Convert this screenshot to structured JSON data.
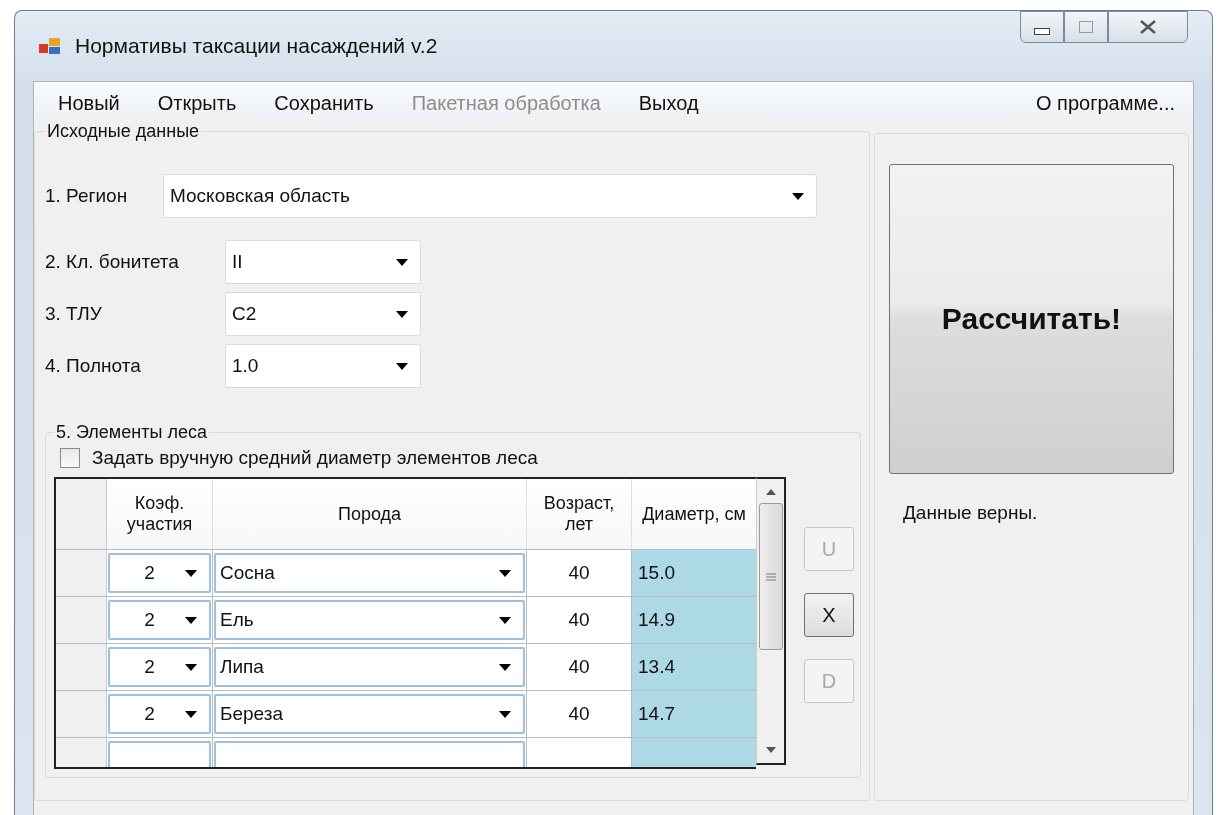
{
  "window": {
    "title": "Нормативы таксации насаждений v.2"
  },
  "menu": [
    {
      "label": "Новый",
      "disabled": false
    },
    {
      "label": "Открыть",
      "disabled": false
    },
    {
      "label": "Сохранить",
      "disabled": false
    },
    {
      "label": "Пакетная обработка",
      "disabled": true
    },
    {
      "label": "Выход",
      "disabled": false
    }
  ],
  "about_menu": "О программе...",
  "input_group": {
    "title": "Исходные данные",
    "fields": [
      {
        "label": "1. Регион",
        "value": "Московская область",
        "kind": "wide"
      },
      {
        "label": "2. Кл. бонитета",
        "value": "II",
        "kind": "short"
      },
      {
        "label": "3. ТЛУ",
        "value": "C2",
        "kind": "short"
      },
      {
        "label": "4. Полнота",
        "value": "1.0",
        "kind": "short"
      }
    ]
  },
  "elements": {
    "title": "5. Элементы леса",
    "checkbox": {
      "label": "Задать вручную средний диаметр элементов леса",
      "checked": false
    },
    "columns": [
      "Коэф. участия",
      "Порода",
      "Возраст, лет",
      "Диаметр, см"
    ],
    "rows": [
      {
        "share": "2",
        "species": "Сосна",
        "age": "40",
        "diameter": "15.0"
      },
      {
        "share": "2",
        "species": "Ель",
        "age": "40",
        "diameter": "14.9"
      },
      {
        "share": "2",
        "species": "Липа",
        "age": "40",
        "diameter": "13.4"
      },
      {
        "share": "2",
        "species": "Береза",
        "age": "40",
        "diameter": "14.7"
      }
    ]
  },
  "row_buttons": [
    {
      "label": "U",
      "disabled": true
    },
    {
      "label": "X",
      "disabled": false
    },
    {
      "label": "D",
      "disabled": true
    }
  ],
  "calculate_button": "Рассчитать!",
  "status": "Данные верны."
}
